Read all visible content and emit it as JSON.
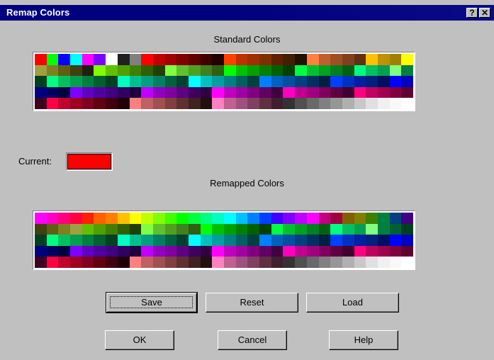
{
  "window": {
    "title": "Remap Colors",
    "help_glyph": "?",
    "close_glyph": "✕"
  },
  "labels": {
    "standard": "Standard Colors",
    "current": "Current:",
    "remapped": "Remapped Colors"
  },
  "current_color": "#ff0000",
  "buttons": {
    "save": "Save",
    "reset": "Reset",
    "load": "Load",
    "ok": "OK",
    "cancel": "Cancel",
    "help": "Help"
  },
  "standard_palette": [
    [
      "#ff0000",
      "#00ff00",
      "#0000ff",
      "#00ffff",
      "#ff00ff",
      "#8000ff",
      "#ffffff",
      "#202020",
      "#808080",
      "#ff0000",
      "#c00000",
      "#a00000",
      "#800000",
      "#600000",
      "#400000",
      "#200000",
      "#ff4000",
      "#c03000",
      "#a03000",
      "#803000",
      "#602000",
      "#402000",
      "#201000",
      "#ff8040",
      "#c06030",
      "#a05020",
      "#804020",
      "#603010",
      "#ffc000",
      "#c09000",
      "#a08000",
      "#ffff00"
    ],
    [
      "#a0a040",
      "#808020",
      "#606010",
      "#404010",
      "#202010",
      "#80ff00",
      "#60c000",
      "#50a000",
      "#408000",
      "#306000",
      "#204000",
      "#80ff40",
      "#60c030",
      "#50a020",
      "#408020",
      "#306010",
      "#00ff00",
      "#00c000",
      "#00a000",
      "#008000",
      "#006000",
      "#004000",
      "#00ff40",
      "#00c030",
      "#00a020",
      "#008020",
      "#006010",
      "#00ff80",
      "#00c060",
      "#00a050",
      "#80ff80",
      "#008040"
    ],
    [
      "#004020",
      "#00ff80",
      "#00c060",
      "#00a050",
      "#008040",
      "#006030",
      "#004020",
      "#00ffc0",
      "#00c090",
      "#00a080",
      "#008060",
      "#006040",
      "#004030",
      "#00ffff",
      "#00c0c0",
      "#00a0a0",
      "#008080",
      "#006060",
      "#004040",
      "#0080ff",
      "#0060c0",
      "#0050a0",
      "#004080",
      "#003060",
      "#002040",
      "#0040ff",
      "#0030c0",
      "#0020a0",
      "#002080",
      "#001060",
      "#0000ff",
      "#0000c0"
    ],
    [
      "#000080",
      "#000060",
      "#000040",
      "#8000ff",
      "#6000c0",
      "#5000a0",
      "#400080",
      "#300060",
      "#200040",
      "#c000ff",
      "#9000c0",
      "#8000a0",
      "#600080",
      "#400060",
      "#300040",
      "#ff00ff",
      "#c000c0",
      "#a000a0",
      "#800080",
      "#600060",
      "#400040",
      "#ff00c0",
      "#c00090",
      "#a00080",
      "#800060",
      "#600040",
      "#400030",
      "#ff0080",
      "#c00060",
      "#a00050",
      "#800040",
      "#600030"
    ],
    [
      "#400020",
      "#ff0040",
      "#c00030",
      "#a00020",
      "#800020",
      "#600010",
      "#400010",
      "#200008",
      "#ff8080",
      "#c06060",
      "#a05050",
      "#804040",
      "#603030",
      "#402020",
      "#201010",
      "#ff80c0",
      "#c06090",
      "#a05080",
      "#804060",
      "#603040",
      "#402030",
      "#333333",
      "#505050",
      "#696969",
      "#808080",
      "#969696",
      "#b0b0b0",
      "#c8c8c8",
      "#e0e0e0",
      "#f0f0f0",
      "#f8f8f8",
      "#ffffff"
    ]
  ],
  "remapped_palette": [
    [
      "#ff00ff",
      "#ff00c0",
      "#ff0080",
      "#ff0040",
      "#ff2000",
      "#ff6000",
      "#ff8000",
      "#ffc000",
      "#ffff00",
      "#c0ff00",
      "#80ff00",
      "#40ff00",
      "#00ff00",
      "#00ff40",
      "#00ff80",
      "#00ffc0",
      "#00ffff",
      "#00c0ff",
      "#0080ff",
      "#0040ff",
      "#4000ff",
      "#8000ff",
      "#c000ff",
      "#ff00ff",
      "#c00080",
      "#a00040",
      "#806000",
      "#808000",
      "#408000",
      "#008040",
      "#004080",
      "#400080"
    ],
    [
      "#404010",
      "#606010",
      "#808020",
      "#a0a040",
      "#60c000",
      "#50a000",
      "#408000",
      "#306000",
      "#204000",
      "#80ff40",
      "#60c030",
      "#50a020",
      "#408020",
      "#306010",
      "#00ff00",
      "#00c000",
      "#00a000",
      "#008000",
      "#006000",
      "#004000",
      "#00ff40",
      "#00c030",
      "#00a020",
      "#008020",
      "#006010",
      "#00ff80",
      "#00c060",
      "#00a050",
      "#80ff80",
      "#008040",
      "#006030",
      "#004020"
    ],
    [
      "#004020",
      "#00ff80",
      "#00c060",
      "#00a050",
      "#008040",
      "#006030",
      "#004020",
      "#00ffc0",
      "#00c090",
      "#00a080",
      "#008060",
      "#006040",
      "#004030",
      "#00ffff",
      "#00c0c0",
      "#00a0a0",
      "#008080",
      "#006060",
      "#004040",
      "#0080ff",
      "#0060c0",
      "#0050a0",
      "#004080",
      "#003060",
      "#002040",
      "#0040ff",
      "#0030c0",
      "#0020a0",
      "#002080",
      "#001060",
      "#0000ff",
      "#0000c0"
    ],
    [
      "#000080",
      "#000060",
      "#000040",
      "#8000ff",
      "#6000c0",
      "#5000a0",
      "#400080",
      "#300060",
      "#200040",
      "#c000ff",
      "#9000c0",
      "#8000a0",
      "#600080",
      "#400060",
      "#300040",
      "#ff00ff",
      "#c000c0",
      "#a000a0",
      "#800080",
      "#600060",
      "#400040",
      "#ff00c0",
      "#c00090",
      "#a00080",
      "#800060",
      "#600040",
      "#400030",
      "#ff0080",
      "#c00060",
      "#a00050",
      "#800040",
      "#600030"
    ],
    [
      "#400020",
      "#ff0040",
      "#c00030",
      "#a00020",
      "#800020",
      "#600010",
      "#400010",
      "#200008",
      "#ff8080",
      "#c06060",
      "#a05050",
      "#804040",
      "#603030",
      "#402020",
      "#201010",
      "#ff80c0",
      "#c06090",
      "#a05080",
      "#804060",
      "#603040",
      "#402030",
      "#333333",
      "#505050",
      "#696969",
      "#808080",
      "#969696",
      "#b0b0b0",
      "#c8c8c8",
      "#e0e0e0",
      "#f0f0f0",
      "#f8f8f8",
      "#ffffff"
    ]
  ]
}
